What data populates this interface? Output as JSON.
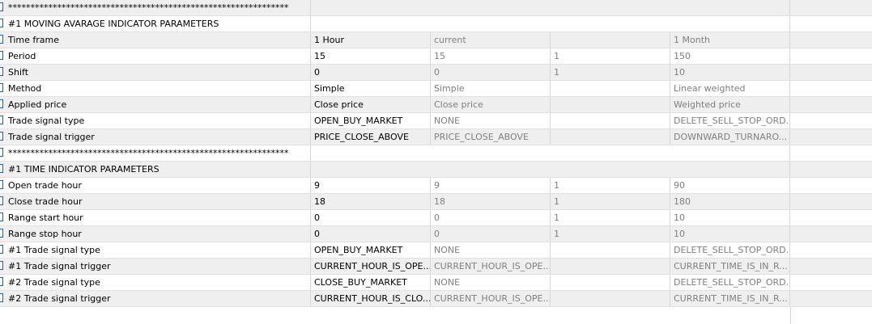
{
  "rows": [
    {
      "name": "***************************************************************",
      "header": true
    },
    {
      "name": "#1 MOVING AVARAGE INDICATOR PARAMETERS",
      "header": true
    },
    {
      "name": "Time frame",
      "value": "1 Hour",
      "start": "current",
      "step": "",
      "stop": "1 Month"
    },
    {
      "name": "Period",
      "value": "15",
      "start": "15",
      "step": "1",
      "stop": "150"
    },
    {
      "name": "Shift",
      "value": "0",
      "start": "0",
      "step": "1",
      "stop": "10"
    },
    {
      "name": "Method",
      "value": "Simple",
      "start": "Simple",
      "step": "",
      "stop": "Linear weighted"
    },
    {
      "name": "Applied price",
      "value": "Close price",
      "start": "Close price",
      "step": "",
      "stop": "Weighted price"
    },
    {
      "name": "Trade signal type",
      "value": "OPEN_BUY_MARKET",
      "start": "NONE",
      "step": "",
      "stop": "DELETE_SELL_STOP_ORD..."
    },
    {
      "name": "Trade signal trigger",
      "value": "PRICE_CLOSE_ABOVE",
      "start": "PRICE_CLOSE_ABOVE",
      "step": "",
      "stop": "DOWNWARD_TURNARO..."
    },
    {
      "name": "***************************************************************",
      "header": true
    },
    {
      "name": "#1 TIME INDICATOR PARAMETERS",
      "header": true
    },
    {
      "name": "Open trade hour",
      "value": "9",
      "start": "9",
      "step": "1",
      "stop": "90"
    },
    {
      "name": "Close trade hour",
      "value": "18",
      "start": "18",
      "step": "1",
      "stop": "180"
    },
    {
      "name": "Range start hour",
      "value": "0",
      "start": "0",
      "step": "1",
      "stop": "10"
    },
    {
      "name": "Range stop hour",
      "value": "0",
      "start": "0",
      "step": "1",
      "stop": "10"
    },
    {
      "name": "#1 Trade signal type",
      "value": "OPEN_BUY_MARKET",
      "start": "NONE",
      "step": "",
      "stop": "DELETE_SELL_STOP_ORD..."
    },
    {
      "name": "#1 Trade signal trigger",
      "value": "CURRENT_HOUR_IS_OPE...",
      "start": "CURRENT_HOUR_IS_OPE...",
      "step": "",
      "stop": "CURRENT_TIME_IS_IN_R..."
    },
    {
      "name": "#2 Trade signal type",
      "value": "CLOSE_BUY_MARKET",
      "start": "NONE",
      "step": "",
      "stop": "DELETE_SELL_STOP_ORD..."
    },
    {
      "name": "#2 Trade signal trigger",
      "value": "CURRENT_HOUR_IS_CLO...",
      "start": "CURRENT_HOUR_IS_OPE...",
      "step": "",
      "stop": "CURRENT_TIME_IS_IN_R..."
    }
  ],
  "colors": {
    "row_alt": "#efefef",
    "checkbox_border": "#1f5fbf",
    "muted_text": "#808080"
  }
}
